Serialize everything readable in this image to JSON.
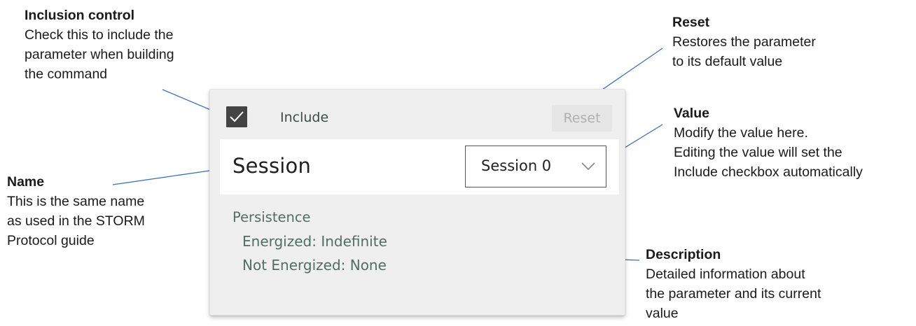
{
  "annotations": {
    "inclusion": {
      "title": "Inclusion control",
      "lines": [
        "Check this to include the",
        "parameter when building",
        "the command"
      ]
    },
    "name": {
      "title": "Name",
      "lines": [
        "This is the same name",
        "as used in the STORM",
        "Protocol guide"
      ]
    },
    "reset": {
      "title": "Reset",
      "lines": [
        "Restores the parameter",
        "to its default value"
      ]
    },
    "value": {
      "title": "Value",
      "lines": [
        "Modify the value here.",
        "Editing the value will set the",
        "Include checkbox automatically"
      ]
    },
    "description": {
      "title": "Description",
      "lines": [
        "Detailed information about",
        "the parameter and its current",
        "value"
      ]
    }
  },
  "card": {
    "include_label": "Include",
    "include_checked": true,
    "reset_label": "Reset",
    "reset_enabled": false,
    "param_name": "Session",
    "value_selected": "Session 0",
    "description_title": "Persistence",
    "description_lines": [
      "Energized: Indefinite",
      "Not Energized: None"
    ]
  },
  "colors": {
    "annotation_line": "#3a6fc4",
    "checkbox_fill": "#444444",
    "description_text": "#4f6e64",
    "card_bg": "#efefef",
    "reset_disabled_text": "#b0b0b0"
  },
  "icons": {
    "checkbox": "checkmark-icon",
    "dropdown": "chevron-down-icon"
  }
}
